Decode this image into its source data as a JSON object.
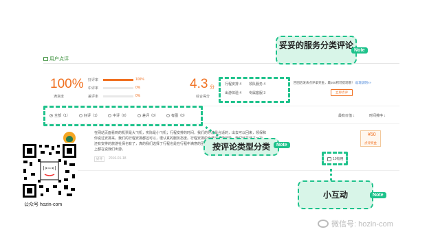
{
  "header": {
    "tab_label": "用户点评"
  },
  "satisfaction": {
    "percent": "100%",
    "label": "满意度",
    "rows": [
      {
        "label": "好评率",
        "value": "100%",
        "fraction": 1.0
      },
      {
        "label": "中评率",
        "value": "0%",
        "fraction": 0
      },
      {
        "label": "差评率",
        "value": "0%",
        "fraction": 0
      }
    ]
  },
  "score": {
    "value": "4.3",
    "unit": "分",
    "label": "综合得分",
    "subs": [
      {
        "label": "行程安排",
        "value": "4"
      },
      {
        "label": "领队服务",
        "value": "4"
      },
      {
        "label": "出游体验",
        "value": "4"
      },
      {
        "label": "专属客服",
        "value": "3"
      }
    ]
  },
  "reward": {
    "text": "回团后发表点评拿奖金，最200积可提现哦！",
    "link": "返现说明>>",
    "button": "立即点评"
  },
  "filters": [
    {
      "label": "全部（1）",
      "selected": true
    },
    {
      "label": "好评（1）",
      "selected": false
    },
    {
      "label": "中评（0）",
      "selected": false
    },
    {
      "label": "差评（0）",
      "selected": false
    },
    {
      "label": "有图（0）",
      "selected": false
    }
  ],
  "sort": {
    "value": "最有价值",
    "time": "时间排序"
  },
  "review": {
    "body": "在网站页面看到的机票是大飞机，实际是小飞机；行程安排的时间，我们的导游是合适的，出去可以回来，领保和你说过安排来，我们的行程安排都还可以，很认真的服务态度。行程安排的全都会出游体验，我们就是活了一次，还有安排的旅游社保也有了，真的我们选择了行程也是在行程中满意的团队。希望同样可以，我们都旅游都和网站上都在说我们出游。",
    "tag": "好评",
    "date": "2016-01-18",
    "useful": "10有用",
    "reward_amount": "¥50",
    "reward_label": "点评奖金"
  },
  "annotations": {
    "service": {
      "title": "妥妥的服务分类评论",
      "note": "Note"
    },
    "type": {
      "title": "按评论类型分类",
      "note": "Note"
    },
    "interact": {
      "title": "小互动",
      "note": "Note"
    }
  },
  "qr_caption": "公众号 hozin-com",
  "watermark": "微信号: hozin-com",
  "colors": {
    "accent": "#f07020",
    "annotation": "#1ec28b",
    "annotation_bg": "#d8f5e8"
  }
}
